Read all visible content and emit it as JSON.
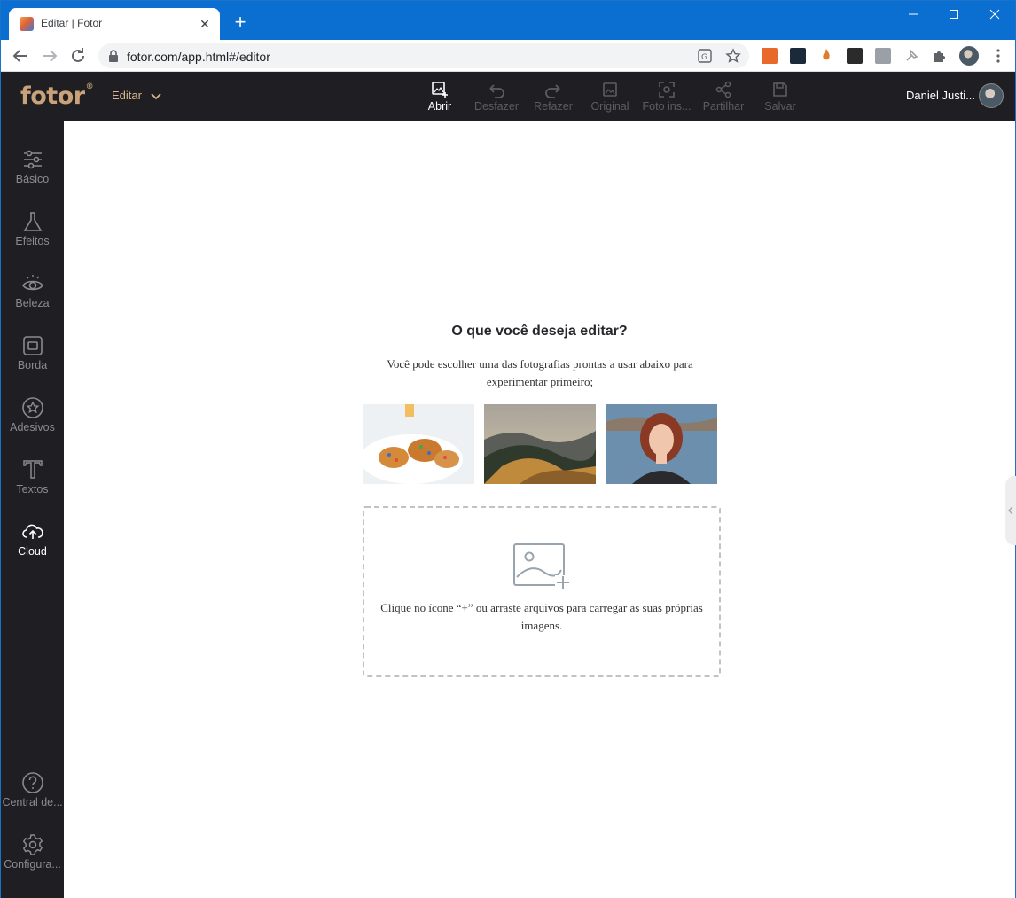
{
  "browser": {
    "tab_title": "Editar | Fotor",
    "tab_close": "✕",
    "new_tab": "+",
    "url": "fotor.com/app.html#/editor"
  },
  "app": {
    "logo": "fotor",
    "logo_mark": "®",
    "mode": "Editar",
    "tools": [
      {
        "label": "Abrir",
        "icon": "add-image-icon",
        "state": "enabled"
      },
      {
        "label": "Desfazer",
        "icon": "undo-icon",
        "state": "disabled"
      },
      {
        "label": "Refazer",
        "icon": "redo-icon",
        "state": "disabled"
      },
      {
        "label": "Original",
        "icon": "original-icon",
        "state": "disabled"
      },
      {
        "label": "Foto ins...",
        "icon": "scan-icon",
        "state": "disabled"
      },
      {
        "label": "Partilhar",
        "icon": "share-icon",
        "state": "disabled"
      },
      {
        "label": "Salvar",
        "icon": "save-icon",
        "state": "disabled"
      }
    ],
    "user_name": "Daniel Justi..."
  },
  "sidebar": {
    "items": [
      {
        "label": "Básico",
        "icon": "sliders-icon"
      },
      {
        "label": "Efeitos",
        "icon": "flask-icon"
      },
      {
        "label": "Beleza",
        "icon": "eye-icon"
      },
      {
        "label": "Borda",
        "icon": "frame-icon"
      },
      {
        "label": "Adesivos",
        "icon": "star-badge-icon"
      },
      {
        "label": "Textos",
        "icon": "text-icon"
      },
      {
        "label": "Cloud",
        "icon": "cloud-upload-icon"
      }
    ],
    "bottom": [
      {
        "label": "Central de...",
        "icon": "help-icon"
      },
      {
        "label": "Configura...",
        "icon": "settings-icon"
      }
    ]
  },
  "editor": {
    "heading": "O que você deseja editar?",
    "subtext": "Você pode escolher uma das fotografias prontas a usar abaixo para experimentar primeiro;",
    "samples": [
      "cookies",
      "mountain-landscape",
      "portrait"
    ],
    "drop_text": "Clique no ícone “+” ou arraste arquivos para carregar as suas próprias imagens."
  },
  "colors": {
    "chrome_blue": "#0a6fd1",
    "app_dark": "#1f1f23",
    "brand": "#c9a27a"
  }
}
